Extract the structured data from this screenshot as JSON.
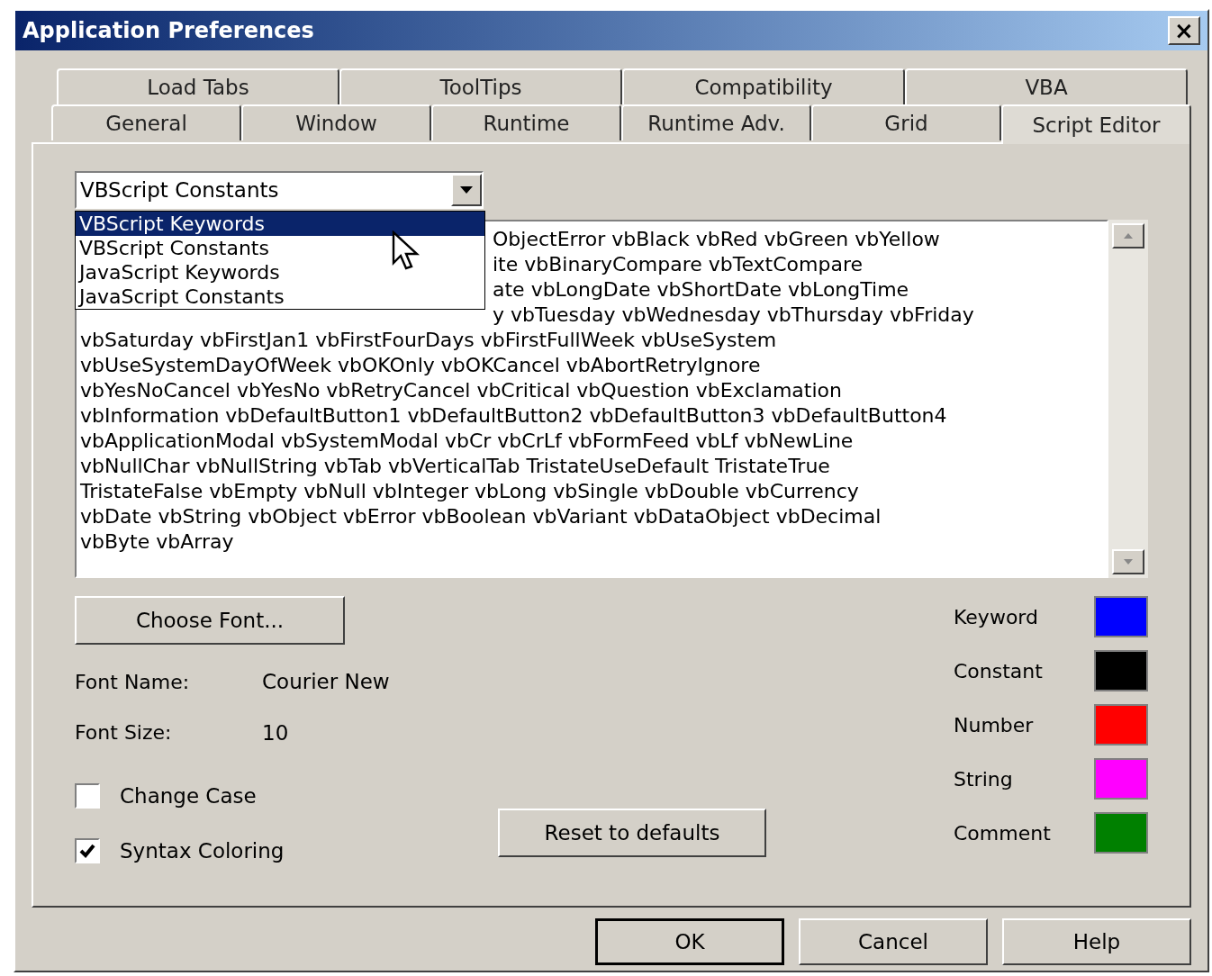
{
  "window": {
    "title": "Application Preferences",
    "close": "×"
  },
  "tab_rows": [
    [
      {
        "label": "Load Tabs",
        "selected": false
      },
      {
        "label": "ToolTips",
        "selected": false
      },
      {
        "label": "Compatibility",
        "selected": false
      },
      {
        "label": "VBA",
        "selected": false
      }
    ],
    [
      {
        "label": "General",
        "selected": false
      },
      {
        "label": "Window",
        "selected": false
      },
      {
        "label": "Runtime",
        "selected": false
      },
      {
        "label": "Runtime Adv.",
        "selected": false
      },
      {
        "label": "Grid",
        "selected": false
      },
      {
        "label": "Script Editor",
        "selected": true
      }
    ]
  ],
  "combo": {
    "value": "VBScript Constants",
    "options": [
      {
        "label": "VBScript Keywords",
        "highlighted": true
      },
      {
        "label": "VBScript Constants",
        "highlighted": false
      },
      {
        "label": "JavaScript Keywords",
        "highlighted": false
      },
      {
        "label": "JavaScript Constants",
        "highlighted": false
      }
    ]
  },
  "editor": {
    "partly_hidden_lines": [
      "ObjectError vbBlack vbRed vbGreen vbYellow",
      "ite vbBinaryCompare vbTextCompare",
      "ate vbLongDate vbShortDate vbLongTime",
      "y vbTuesday vbWednesday vbThursday vbFriday"
    ],
    "lines": [
      "vbSaturday vbFirstJan1 vbFirstFourDays vbFirstFullWeek vbUseSystem",
      "vbUseSystemDayOfWeek vbOKOnly vbOKCancel vbAbortRetryIgnore",
      "vbYesNoCancel vbYesNo vbRetryCancel vbCritical vbQuestion vbExclamation",
      "vbInformation vbDefaultButton1 vbDefaultButton2 vbDefaultButton3 vbDefaultButton4",
      "vbApplicationModal vbSystemModal vbCr vbCrLf vbFormFeed vbLf vbNewLine",
      "vbNullChar vbNullString vbTab vbVerticalTab TristateUseDefault TristateTrue",
      "TristateFalse vbEmpty vbNull vbInteger vbLong vbSingle vbDouble vbCurrency",
      "vbDate vbString vbObject vbError vbBoolean vbVariant vbDataObject vbDecimal",
      "vbByte vbArray"
    ]
  },
  "choose_font_button": "Choose Font...",
  "font_info": [
    {
      "label": "Font Name:",
      "value": "Courier New"
    },
    {
      "label": "Font Size:",
      "value": "10"
    }
  ],
  "checkboxes": [
    {
      "label": "Change Case",
      "checked": false
    },
    {
      "label": "Syntax Coloring",
      "checked": true
    }
  ],
  "reset_button": "Reset to defaults",
  "colors": [
    {
      "label": "Keyword",
      "color": "#0000ff"
    },
    {
      "label": "Constant",
      "color": "#000000"
    },
    {
      "label": "Number",
      "color": "#ff0000"
    },
    {
      "label": "String",
      "color": "#ff00ff"
    },
    {
      "label": "Comment",
      "color": "#008000"
    }
  ],
  "buttons": [
    {
      "label": "OK",
      "default": true
    },
    {
      "label": "Cancel",
      "default": false
    },
    {
      "label": "Help",
      "default": false
    }
  ]
}
